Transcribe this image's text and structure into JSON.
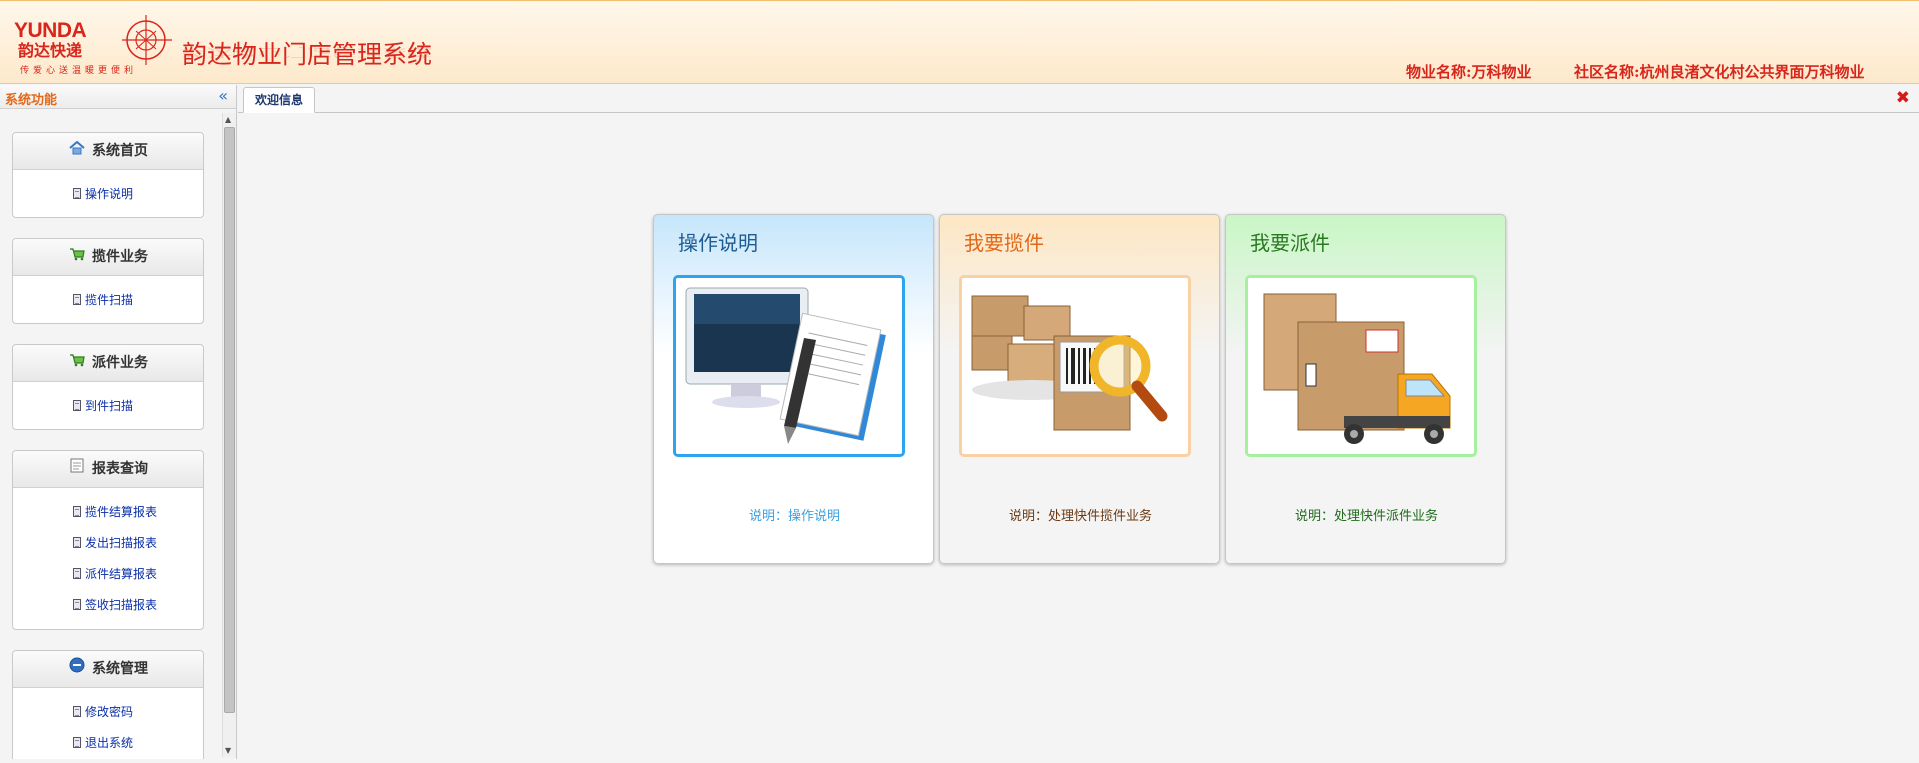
{
  "header": {
    "logo_en": "YUNDA",
    "logo_cn": "韵达快递",
    "logo_slogan": "传爱心送温暖更便利",
    "app_title": "韵达物业门店管理系统",
    "property_label": "物业名称:万科物业",
    "community_label": "社区名称:杭州良渚文化村公共界面万科物业"
  },
  "sidebar": {
    "title": "系统功能",
    "collapse_icon": "«",
    "panels": [
      {
        "title": "系统首页",
        "icon": "home-icon",
        "items": [
          "操作说明"
        ]
      },
      {
        "title": "揽件业务",
        "icon": "cart-icon",
        "items": [
          "揽件扫描"
        ]
      },
      {
        "title": "派件业务",
        "icon": "cart-icon",
        "items": [
          "到件扫描"
        ]
      },
      {
        "title": "报表查询",
        "icon": "report-icon",
        "items": [
          "揽件结算报表",
          "发出扫描报表",
          "派件结算报表",
          "签收扫描报表"
        ]
      },
      {
        "title": "系统管理",
        "icon": "minus-circle-icon",
        "items": [
          "修改密码",
          "退出系统"
        ]
      }
    ]
  },
  "tabs": [
    {
      "label": "欢迎信息",
      "active": true
    }
  ],
  "cards": [
    {
      "title": "操作说明",
      "desc": "说明：操作说明",
      "image": "computer-document-illustration"
    },
    {
      "title": "我要揽件",
      "desc": "说明：处理快件揽件业务",
      "image": "boxes-barcode-magnifier-illustration"
    },
    {
      "title": "我要派件",
      "desc": "说明：处理快件派件业务",
      "image": "delivery-truck-boxes-illustration"
    }
  ],
  "colors": {
    "brand_red": "#d9261c",
    "link_blue": "#0a2ea8",
    "card1_accent": "#2da4ee",
    "card2_accent": "#e06818",
    "card3_accent": "#2a7a22"
  }
}
